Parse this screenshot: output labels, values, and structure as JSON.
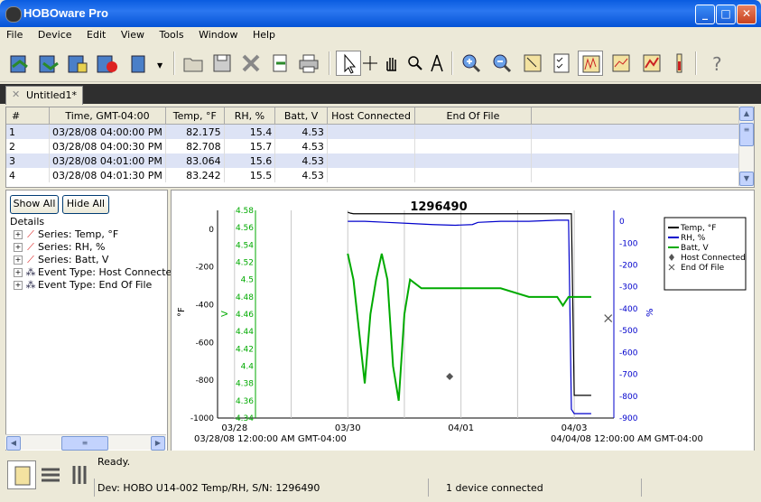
{
  "window": {
    "title": "HOBOware Pro"
  },
  "menu": [
    "File",
    "Device",
    "Edit",
    "View",
    "Tools",
    "Window",
    "Help"
  ],
  "tab": {
    "label": "Untitled1*"
  },
  "table": {
    "headers": [
      "#",
      "Time, GMT-04:00",
      "Temp, °F",
      "RH, %",
      "Batt, V",
      "Host Connected",
      "End Of File"
    ],
    "rows": [
      [
        "1",
        "03/28/08 04:00:00 PM",
        "82.175",
        "15.4",
        "4.53",
        "",
        ""
      ],
      [
        "2",
        "03/28/08 04:00:30 PM",
        "82.708",
        "15.7",
        "4.53",
        "",
        ""
      ],
      [
        "3",
        "03/28/08 04:01:00 PM",
        "83.064",
        "15.6",
        "4.53",
        "",
        ""
      ],
      [
        "4",
        "03/28/08 04:01:30 PM",
        "83.242",
        "15.5",
        "4.53",
        "",
        ""
      ]
    ]
  },
  "left": {
    "show_all": "Show All",
    "hide_all": "Hide All",
    "details": "Details",
    "tree": [
      {
        "label": "Series: Temp, °F",
        "icon": "series-icon"
      },
      {
        "label": "Series: RH, %",
        "icon": "series-icon"
      },
      {
        "label": "Series: Batt, V",
        "icon": "series-icon"
      },
      {
        "label": "Event Type: Host Connected",
        "icon": "event-icon"
      },
      {
        "label": "Event Type: End Of File",
        "icon": "event-icon"
      }
    ]
  },
  "chart_data": {
    "type": "line",
    "title": "1296490",
    "x_ticks": [
      "03/28",
      "03/30",
      "04/01",
      "04/03"
    ],
    "x_range_labels": {
      "start": "03/28/08 12:00:00 AM GMT-04:00",
      "end": "04/04/08 12:00:00 AM GMT-04:00"
    },
    "xlim_days": [
      0,
      7
    ],
    "axes": [
      {
        "label": "°F",
        "color": "#000000",
        "side": "left",
        "ticks": [
          "0",
          "-200",
          "-400",
          "-600",
          "-800",
          "-1000"
        ],
        "ylim": [
          -1000,
          100
        ]
      },
      {
        "label": "V",
        "color": "#00aa00",
        "side": "left",
        "ticks": [
          "4.58",
          "4.56",
          "4.54",
          "4.52",
          "4.5",
          "4.48",
          "4.46",
          "4.44",
          "4.42",
          "4.4",
          "4.38",
          "4.36",
          "4.34"
        ],
        "ylim": [
          4.34,
          4.58
        ]
      },
      {
        "label": "%",
        "color": "#0000cc",
        "side": "right",
        "ticks": [
          "0",
          "-100",
          "-200",
          "-300",
          "-400",
          "-500",
          "-600",
          "-700",
          "-800",
          "-900"
        ],
        "ylim": [
          -900,
          50
        ]
      }
    ],
    "series": [
      {
        "name": "Temp, °F",
        "color": "#000000",
        "axis": 0,
        "x": [
          2.3,
          2.35,
          2.4,
          2.45,
          2.6,
          2.75,
          2.85,
          3.2,
          3.4,
          3.45,
          3.6,
          4.0,
          4.5,
          5.0,
          5.5,
          6.0,
          6.2,
          6.25,
          6.3,
          6.4,
          6.6
        ],
        "y": [
          90,
          85,
          82,
          82,
          82,
          82,
          82,
          82,
          82,
          82,
          82,
          82,
          82,
          82,
          82,
          82,
          82,
          82,
          -880,
          -880,
          -880
        ]
      },
      {
        "name": "RH, %",
        "color": "#0000cc",
        "axis": 2,
        "x": [
          2.3,
          2.6,
          3.0,
          3.4,
          3.8,
          4.2,
          4.5,
          4.6,
          5.0,
          5.5,
          6.0,
          6.2,
          6.25,
          6.3,
          6.6
        ],
        "y": [
          0,
          0,
          -5,
          -10,
          -15,
          -18,
          -15,
          -5,
          0,
          0,
          5,
          5,
          -860,
          -880,
          -880
        ]
      },
      {
        "name": "Batt, V",
        "color": "#00aa00",
        "axis": 1,
        "x": [
          2.3,
          2.4,
          2.5,
          2.6,
          2.7,
          2.8,
          2.9,
          3.0,
          3.1,
          3.2,
          3.3,
          3.4,
          3.6,
          4.0,
          4.5,
          5.0,
          5.5,
          6.0,
          6.1,
          6.2,
          6.4,
          6.6
        ],
        "y": [
          4.53,
          4.5,
          4.44,
          4.38,
          4.46,
          4.5,
          4.53,
          4.5,
          4.4,
          4.36,
          4.46,
          4.5,
          4.49,
          4.49,
          4.49,
          4.49,
          4.48,
          4.48,
          4.47,
          4.48,
          4.48,
          4.48
        ]
      }
    ],
    "events": [
      {
        "name": "Host Connected",
        "x": 4.1,
        "y_pct": 0.8,
        "symbol": "diamond"
      },
      {
        "name": "End Of File",
        "x": 6.9,
        "y_pct": 0.52,
        "symbol": "x"
      }
    ],
    "legend": {
      "position": "top-right",
      "entries": [
        "Temp, °F",
        "RH, %",
        "Batt, V",
        "Host Connected",
        "End Of File"
      ]
    },
    "grid": true
  },
  "status": {
    "ready": "Ready.",
    "device": "Dev: HOBO U14-002 Temp/RH, S/N: 1296490",
    "connection": "1 device connected"
  }
}
